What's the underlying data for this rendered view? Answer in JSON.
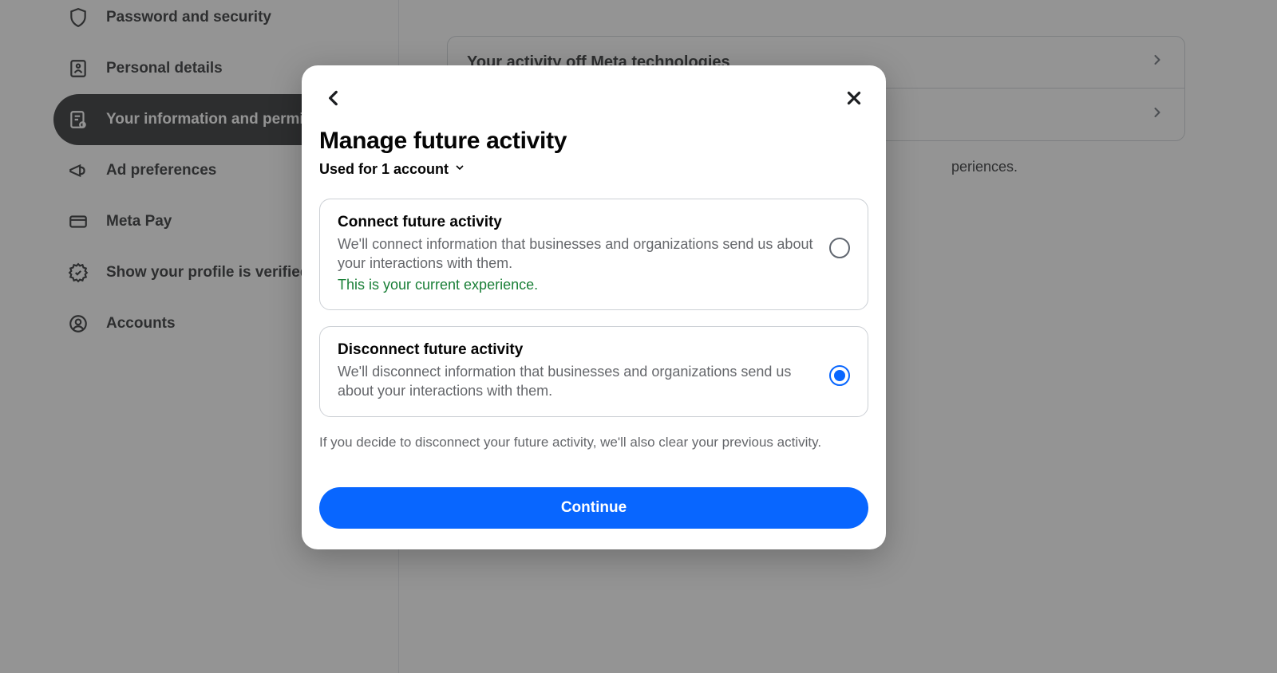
{
  "sidebar": {
    "items": [
      {
        "label": "Password and security"
      },
      {
        "label": "Personal details"
      },
      {
        "label": "Your information and permissions"
      },
      {
        "label": "Ad preferences"
      },
      {
        "label": "Meta Pay"
      },
      {
        "label": "Show your profile is verified"
      },
      {
        "label": "Accounts"
      }
    ]
  },
  "main": {
    "card1": "Your activity off Meta technologies",
    "card2": "",
    "helper_suffix": "periences."
  },
  "modal": {
    "title": "Manage future activity",
    "subtitle": "Used for 1 account",
    "options": [
      {
        "title": "Connect future activity",
        "desc": "We'll connect information that businesses and organizations send us about your interactions with them.",
        "current": "This is your current experience.",
        "selected": false
      },
      {
        "title": "Disconnect future activity",
        "desc": "We'll disconnect information that businesses and organizations send us about your interactions with them.",
        "current": "",
        "selected": true
      }
    ],
    "note": "If you decide to disconnect your future activity, we'll also clear your previous activity.",
    "continue": "Continue"
  }
}
